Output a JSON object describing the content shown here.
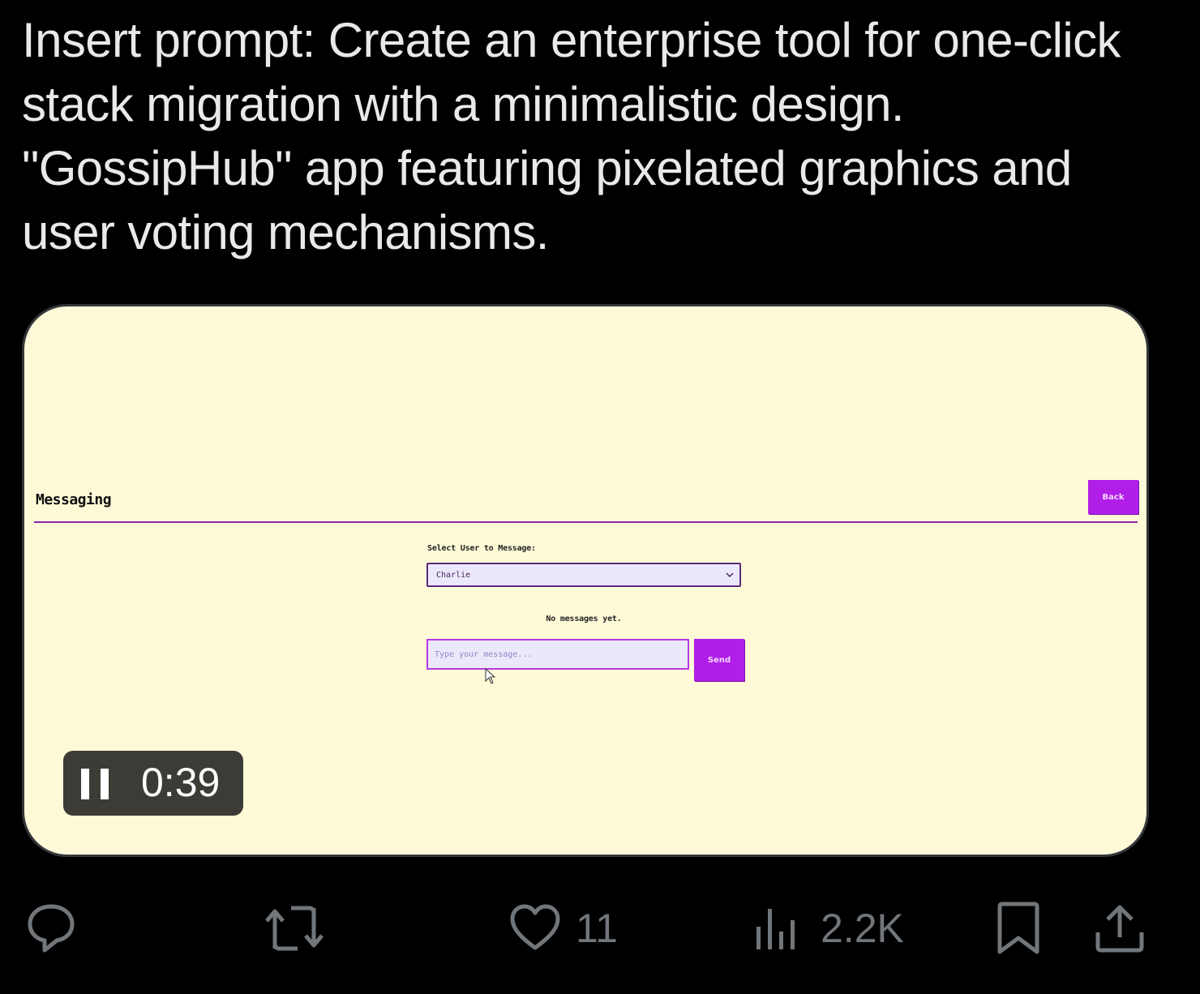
{
  "post": {
    "text": "Insert prompt: Create an enterprise tool for one-click stack migration with a minimalistic design. \"GossipHub\" app featuring pixelated graphics and user voting mechanisms."
  },
  "video": {
    "app": {
      "title": "Messaging",
      "back_label": "Back",
      "select_label": "Select User to Message:",
      "selected_user": "Charlie",
      "empty_state": "No messages yet.",
      "message_placeholder": "Type your message...",
      "send_label": "Send"
    },
    "player": {
      "state": "playing",
      "control_icon": "pause-icon",
      "time": "0:39"
    }
  },
  "actions": {
    "reply": {
      "icon": "reply-icon",
      "count": ""
    },
    "repost": {
      "icon": "repost-icon",
      "count": ""
    },
    "like": {
      "icon": "heart-icon",
      "count": "11"
    },
    "views": {
      "icon": "views-chart-icon",
      "count": "2.2K"
    },
    "bookmark": {
      "icon": "bookmark-icon"
    },
    "share": {
      "icon": "share-icon"
    }
  },
  "colors": {
    "page_background": "#000000",
    "text_primary": "#e7e9ea",
    "text_secondary": "#71767b",
    "app_background": "#fefad8",
    "app_accent": "#b01ee8",
    "input_background": "#ece8fb"
  }
}
